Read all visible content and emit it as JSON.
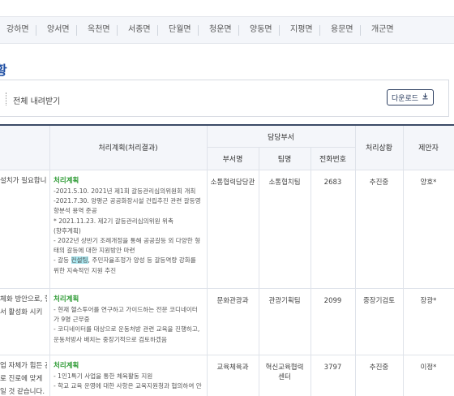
{
  "regions": [
    "강하면",
    "양서면",
    "옥천면",
    "서종면",
    "단월면",
    "청운면",
    "양동면",
    "지평면",
    "용문면",
    "개군면"
  ],
  "section_title": "황",
  "download": {
    "label": "전체 내려받기",
    "button_label": "다운로드",
    "icon": "download-icon"
  },
  "table": {
    "headers": {
      "plan": "처리계획(처리결과)",
      "department_group": "담당부서",
      "dept_name": "부서명",
      "team_name": "팀명",
      "phone": "전화번호",
      "status": "처리상황",
      "proposer": "제안자"
    },
    "rows": [
      {
        "left_text": [
          "설치가 필요합니"
        ],
        "plan_title": "처리계획",
        "plan_lines": [
          "-2021.5.10. 2021년 제1회 갈등관리심의위원회 개최",
          "-2021.7.30. 양평군 공공화장시설 건립추진 관련 갈등영",
          "향분석 용역 준공",
          "* 2021.11.23. 제2기 갈등관리심의위원 위촉",
          "(향후계획)",
          "- 2022년 상반기 조례개정을 통해 공공갈등 외 다양한 형",
          "태의 갈등에 대한 지원방안 마련"
        ],
        "plan_hl_prefix": "- 갈등 ",
        "plan_hl": "컨설팅",
        "plan_hl_suffix": ", 주민자율조정가 양성 등 갈등역량 강화를",
        "plan_last": "위한 지속적인 지원 추진",
        "dept": "소통협력담당관",
        "team": "소통협치팀",
        "phone": "2683",
        "status": "추진중",
        "proposer": "양호*"
      },
      {
        "left_text": [
          "체화 방안으로, 헬",
          "서 활성화 시키"
        ],
        "plan_title": "처리계획",
        "plan_lines": [
          "- 현재 헬스투어를 연구하고 가이드하는 전문 코디네이터",
          "가 9명 근무중",
          "- 코디네이터를 대상으로 운동처방 관련 교육을 진행하고,",
          "운동처방사 배치는 중장기적으로 검토하겠음"
        ],
        "dept": "문화관광과",
        "team": "관광기획팀",
        "phone": "2099",
        "status": "중장기검토",
        "proposer": "장광*"
      },
      {
        "left_text": [
          "업 자체가 힘든 관",
          "로 진로에 맞게",
          "일 것 같습니다."
        ],
        "plan_title": "처리계획",
        "plan_lines": [
          "- 1인1특기 사업을 통한 체육활동 지원",
          "- 학교 교육 운영에 대한 사항은 교육지원청과 협의하여 안"
        ],
        "dept": "교육체육과",
        "team": "혁신교육협력센터",
        "phone": "3797",
        "status": "추진중",
        "proposer": "이정*"
      }
    ]
  }
}
